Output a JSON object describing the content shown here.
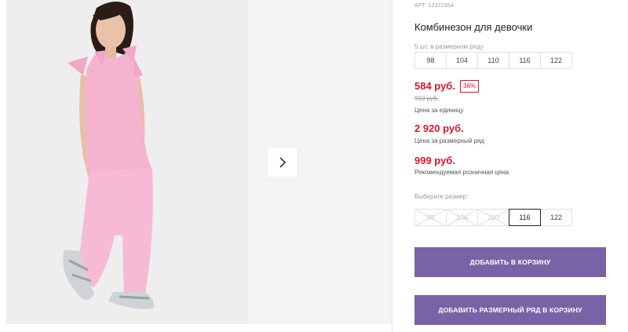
{
  "product": {
    "sku": "АРТ. 12322354",
    "title": "Комбинезон для девочки",
    "size_row_note": "5 шт. в размерном ряду",
    "size_row": [
      "98",
      "104",
      "110",
      "116",
      "122"
    ]
  },
  "pricing": {
    "unit_price": "584 руб.",
    "discount": "36%",
    "old_price": "910 руб.",
    "unit_note": "Цена за единицу",
    "row_price": "2 920 руб.",
    "row_note": "Цена за размерный ряд",
    "rrp": "999 руб.",
    "rrp_note": "Рекомендуемая розничная цена"
  },
  "size_select": {
    "label": "Выберите размер:",
    "sizes": [
      "98",
      "104",
      "110",
      "116",
      "122"
    ],
    "disabled": [
      "98",
      "104",
      "110"
    ],
    "selected": "116"
  },
  "buttons": {
    "add_to_cart": "ДОБАВИТЬ В КОРЗИНУ",
    "add_row_to_cart": "ДОБАВИТЬ РАЗМЕРНЫЙ РЯД В КОРЗИНУ"
  },
  "icons": {
    "next": "chevron-right-icon"
  },
  "colors": {
    "accent": "#7a62a7",
    "price": "#d0192e",
    "dress": "#f4b3cf"
  }
}
